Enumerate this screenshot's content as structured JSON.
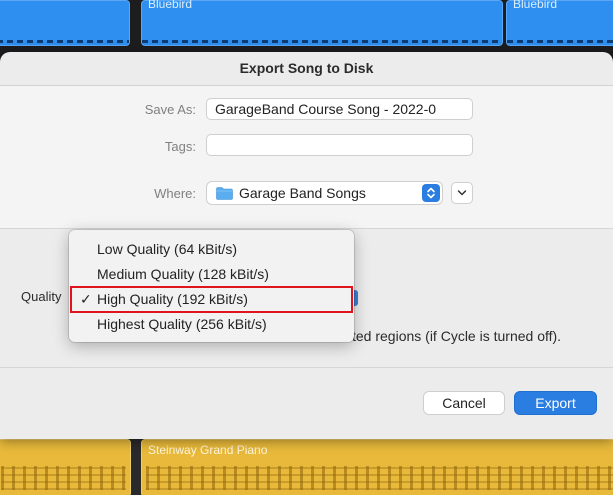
{
  "background": {
    "top_regions": [
      {
        "name": ""
      },
      {
        "name": "Bluebird"
      },
      {
        "name": "Bluebird"
      }
    ],
    "bottom_regions": [
      {
        "name": ""
      },
      {
        "name": "Steinway Grand Piano"
      }
    ]
  },
  "dialog": {
    "title": "Export Song to Disk",
    "save_as": {
      "label": "Save As:",
      "value": "GarageBand Course Song - 2022-0"
    },
    "tags": {
      "label": "Tags:",
      "value": ""
    },
    "where": {
      "label": "Where:",
      "value": "Garage Band Songs"
    },
    "quality": {
      "label": "Quality",
      "menu_items": [
        {
          "label": "Low Quality (64 kBit/s)",
          "checked": false
        },
        {
          "label": "Medium Quality (128 kBit/s)",
          "checked": false
        },
        {
          "label": "High Quality (192 kBit/s)",
          "checked": true
        },
        {
          "label": "Highest Quality (256 kBit/s)",
          "checked": false
        }
      ],
      "check_glyph": "✓"
    },
    "cycle_option_text": "ted regions (if Cycle is turned off).",
    "buttons": {
      "cancel": "Cancel",
      "export": "Export"
    }
  },
  "colors": {
    "accent_blue": "#2a7de1",
    "highlight_red": "#e0141c",
    "region_blue": "#2f8ff0",
    "region_yellow": "#e8b93a"
  }
}
